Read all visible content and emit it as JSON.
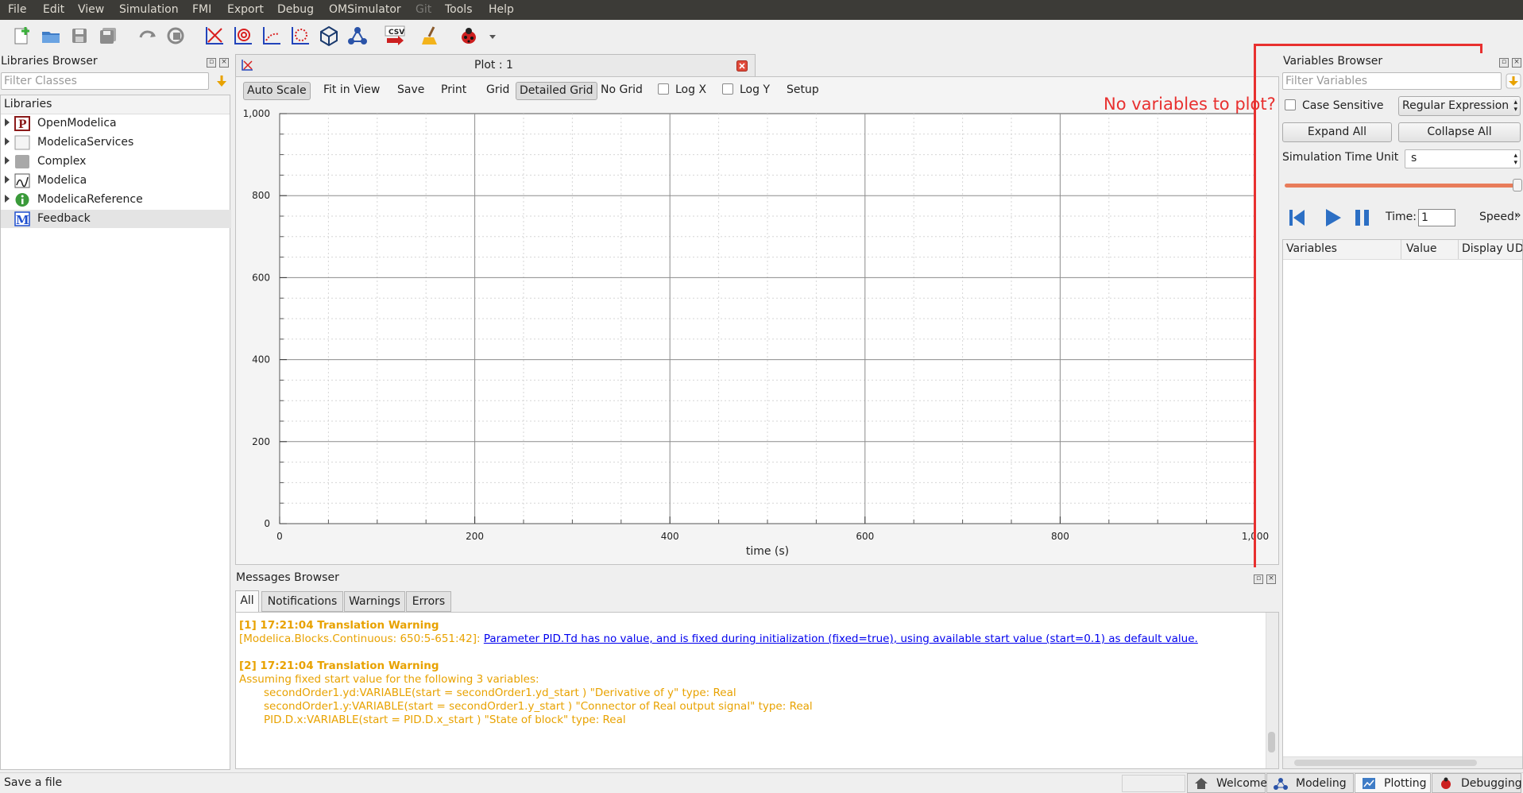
{
  "menu": [
    "File",
    "Edit",
    "View",
    "Simulation",
    "FMI",
    "Export",
    "Debug",
    "OMSimulator",
    "Git",
    "Tools",
    "Help"
  ],
  "toolbar_icons": [
    "new-model-icon",
    "open-folder-icon",
    "save-icon",
    "save-all-icon",
    "undo-redo-icon",
    "check-model-icon",
    "plot-xy-icon",
    "plot-parametric-icon",
    "plot-array-icon",
    "plot-array-parametric-icon",
    "animation-icon",
    "network-icon",
    "export-csv-icon",
    "clear-icon",
    "debugger-icon"
  ],
  "toolbar_csv_label": "CSV",
  "libraries": {
    "title": "Libraries Browser",
    "filter_placeholder": "Filter Classes",
    "header": "Libraries",
    "items": [
      {
        "label": "OpenModelica",
        "icon": "package-p-icon",
        "expandable": true
      },
      {
        "label": "ModelicaServices",
        "icon": "blank-class-icon",
        "expandable": true
      },
      {
        "label": "Complex",
        "icon": "record-gray-icon",
        "expandable": true
      },
      {
        "label": "Modelica",
        "icon": "modelica-graph-icon",
        "expandable": true
      },
      {
        "label": "ModelicaReference",
        "icon": "info-icon",
        "expandable": true
      },
      {
        "label": "Feedback",
        "icon": "model-m-icon",
        "expandable": false
      }
    ]
  },
  "plot": {
    "title": "Plot : 1",
    "buttons": {
      "auto_scale": "Auto Scale",
      "fit_in_view": "Fit in View",
      "save": "Save",
      "print": "Print",
      "grid": "Grid",
      "detailed_grid": "Detailed Grid",
      "no_grid": "No Grid",
      "log_x": "Log X",
      "log_y": "Log Y",
      "setup": "Setup"
    },
    "annotation": "No variables to plot?",
    "annotation_color": "#e8302f"
  },
  "chart_data": {
    "type": "line",
    "series": [],
    "xlabel": "time (s)",
    "ylabel": "",
    "xlim": [
      0,
      1000
    ],
    "ylim": [
      0,
      1000
    ],
    "x_ticks": [
      "0",
      "200",
      "400",
      "600",
      "800",
      "1,000"
    ],
    "y_ticks": [
      "0",
      "200",
      "400",
      "600",
      "800",
      "1,000"
    ],
    "grid": "detailed"
  },
  "messages": {
    "title": "Messages Browser",
    "tabs": [
      "All",
      "Notifications",
      "Warnings",
      "Errors"
    ],
    "m1_head": "[1] 17:21:04 Translation Warning",
    "m1_loc": "[Modelica.Blocks.Continuous: 650:5-651:42]:",
    "m1_link": "Parameter PID.Td has no value, and is fixed during initialization (fixed=true), using available start value (start=0.1) as default value.",
    "m2_head": "[2] 17:21:04 Translation Warning",
    "m2_line1": "Assuming fixed start value for the following 3 variables:",
    "m2_line2": "secondOrder1.yd:VARIABLE(start = secondOrder1.yd_start )  \"Derivative of y\" type: Real",
    "m2_line3": "secondOrder1.y:VARIABLE(start = secondOrder1.y_start )  \"Connector of Real output signal\" type: Real",
    "m2_line4": "PID.D.x:VARIABLE(start = PID.D.x_start )  \"State of block\" type: Real",
    "warning_color": "#e8a200",
    "link_color": "#0000ee"
  },
  "variables": {
    "title": "Variables Browser",
    "filter_placeholder": "Filter Variables",
    "case_sensitive": "Case Sensitive",
    "regex": "Regular Expression",
    "expand_all": "Expand All",
    "collapse_all": "Collapse All",
    "time_unit_label": "Simulation Time Unit",
    "time_unit_value": "s",
    "time_label": "Time:",
    "time_value": "1",
    "speed_label": "Speed:",
    "columns": [
      "Variables",
      "Value",
      "Display U",
      "D"
    ]
  },
  "status": {
    "text": "Save a file"
  },
  "perspectives": [
    {
      "label": "Welcome",
      "icon": "welcome-icon"
    },
    {
      "label": "Modeling",
      "icon": "modeling-icon"
    },
    {
      "label": "Plotting",
      "icon": "plotting-icon",
      "active": true
    },
    {
      "label": "Debugging",
      "icon": "debugging-icon"
    }
  ]
}
